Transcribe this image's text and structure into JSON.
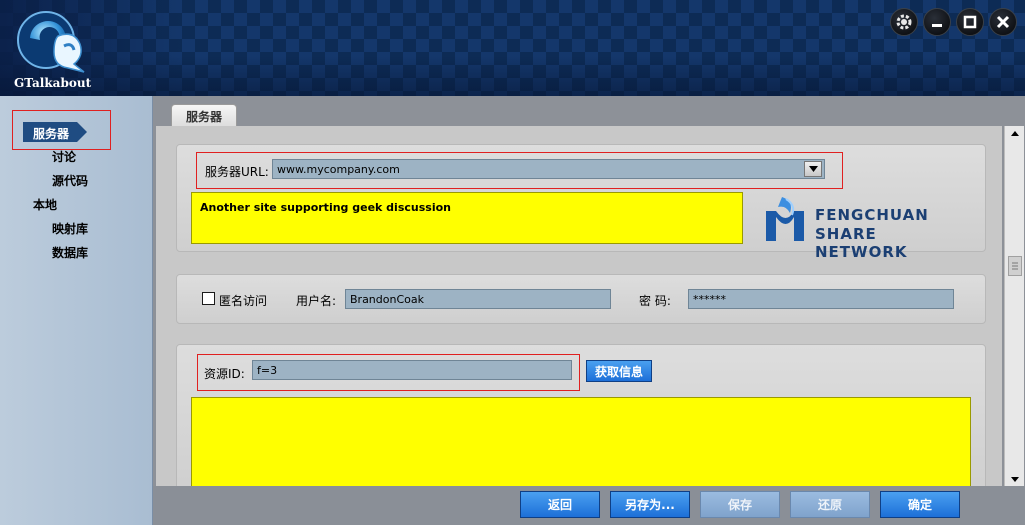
{
  "app": {
    "brand": "GTalkabout"
  },
  "window_controls": [
    {
      "name": "settings",
      "icon": "gear-icon"
    },
    {
      "name": "minimize",
      "icon": "minimize-icon"
    },
    {
      "name": "maximize",
      "icon": "maximize-icon"
    },
    {
      "name": "close",
      "icon": "close-icon"
    }
  ],
  "sidebar": {
    "items": [
      {
        "label": "服务器",
        "active": true
      },
      {
        "label": "讨论"
      },
      {
        "label": "源代码"
      },
      {
        "label": "本地"
      },
      {
        "label": "映射库"
      },
      {
        "label": "数据库"
      }
    ]
  },
  "tabs": [
    {
      "label": "服务器"
    }
  ],
  "server": {
    "url_label": "服务器URL:",
    "url_value": "www.mycompany.com",
    "description": "Another site supporting geek discussion",
    "sponsor_line1": "FENGCHUAN",
    "sponsor_line2": "SHARE NETWORK"
  },
  "auth": {
    "anonymous_label": "匿名访问",
    "anonymous_checked": false,
    "username_label": "用户名:",
    "username_value": "BrandonCoak",
    "password_label": "密  码:",
    "password_value": "******"
  },
  "resource": {
    "id_label": "资源ID:",
    "id_value": "f=3",
    "fetch_button": "获取信息"
  },
  "footer": {
    "back": "返回",
    "save_as": "另存为...",
    "save": "保存",
    "restore": "还原",
    "confirm": "确定"
  },
  "colors": {
    "accent": "#1d6fd8",
    "highlight_yellow": "#ffff00",
    "header": "#0d2b55",
    "sidebar": "#b3c4d7"
  }
}
